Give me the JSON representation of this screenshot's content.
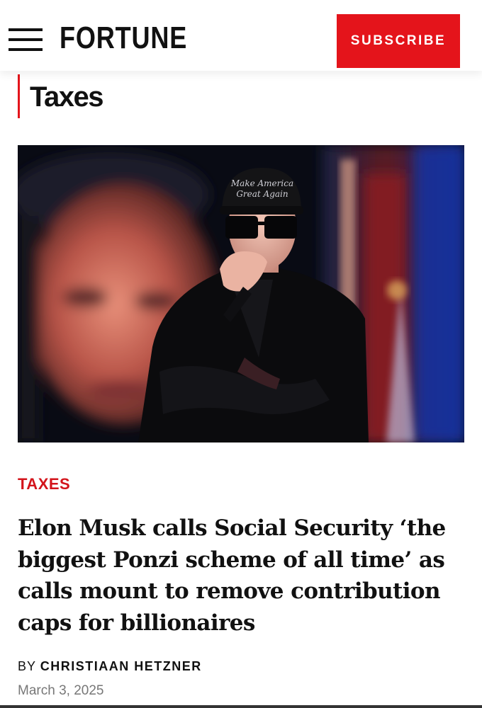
{
  "header": {
    "logo": "FORTUNE",
    "subscribe_label": "SUBSCRIBE",
    "menu_icon": "hamburger-menu-icon"
  },
  "section": {
    "title": "Taxes"
  },
  "hero_image": {
    "cap_text_line1": "Make America",
    "cap_text_line2": "Great Again"
  },
  "article": {
    "category": "TAXES",
    "headline": "Elon Musk calls Social Security ‘the biggest Ponzi scheme of all time’ as calls mount to remove contribution caps for billionaires",
    "byline_prefix": "BY",
    "author": "CHRISTIAAN HETZNER",
    "date": "March 3, 2025"
  },
  "colors": {
    "accent_red": "#e4141b",
    "text": "#111111",
    "muted": "#777777"
  }
}
